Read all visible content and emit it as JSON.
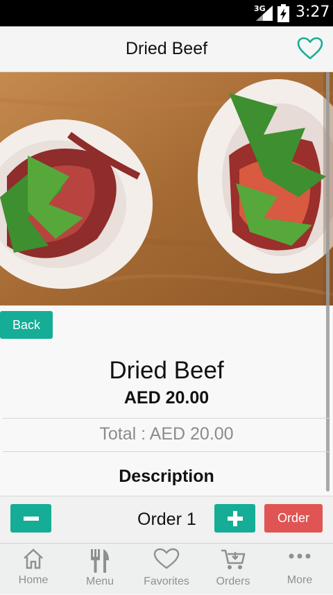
{
  "status_bar": {
    "network": "3G",
    "time": "3:27"
  },
  "header": {
    "title": "Dried Beef"
  },
  "back_label": "Back",
  "product": {
    "name": "Dried Beef",
    "price": "AED 20.00",
    "total": "Total : AED 20.00",
    "description_heading": "Description"
  },
  "order_bar": {
    "minus_symbol": "−",
    "plus_symbol": "+",
    "order_count_label": "Order 1",
    "order_button": "Order"
  },
  "tabs": [
    {
      "label": "Home",
      "icon": "home-icon"
    },
    {
      "label": "Menu",
      "icon": "fork-knife-icon"
    },
    {
      "label": "Favorites",
      "icon": "heart-icon"
    },
    {
      "label": "Orders",
      "icon": "cart-icon"
    },
    {
      "label": "More",
      "icon": "more-dots-icon"
    }
  ],
  "colors": {
    "accent": "#15ad95",
    "order_button": "#e05553",
    "status_bar": "#000000"
  }
}
